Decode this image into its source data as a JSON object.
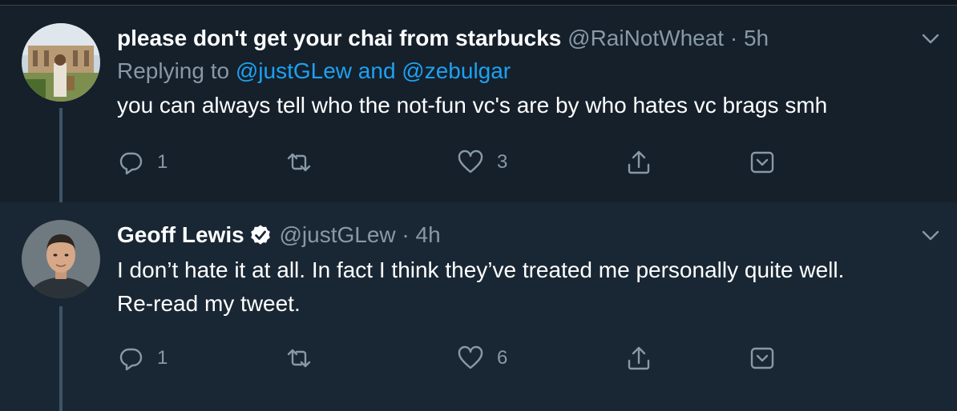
{
  "colors": {
    "background": "#15202b",
    "background_highlight": "#192734",
    "text": "#ffffff",
    "secondary_text": "#8899a6",
    "link": "#1da1f2",
    "thread_line": "#3d5466"
  },
  "tweets": [
    {
      "display_name": "please don't get your chai from starbucks",
      "handle": "@RaiNotWheat",
      "separator": "·",
      "time": "5h",
      "replying_prefix": "Replying to",
      "replying_user_1": "@justGLew",
      "replying_conjunction": "and",
      "replying_user_2": "@zebulgar",
      "text_line_1": "you can always tell who the not-fun vc's are by who hates vc brags smh",
      "reply_count": "1",
      "retweet_count": "",
      "like_count": "3",
      "verified": false
    },
    {
      "display_name": "Geoff Lewis",
      "handle": "@justGLew",
      "separator": "·",
      "time": "4h",
      "text_line_1": "I don’t hate it at all. In fact I think they’ve treated me personally quite well.",
      "text_line_2": "Re-read my tweet.",
      "reply_count": "1",
      "retweet_count": "",
      "like_count": "6",
      "verified": true
    }
  ],
  "icons": {
    "reply": "reply-icon",
    "retweet": "retweet-icon",
    "like": "heart-icon",
    "share": "share-icon",
    "bookmark": "bookmark-icon",
    "more": "chevron-down-icon",
    "verified": "verified-badge-icon"
  }
}
